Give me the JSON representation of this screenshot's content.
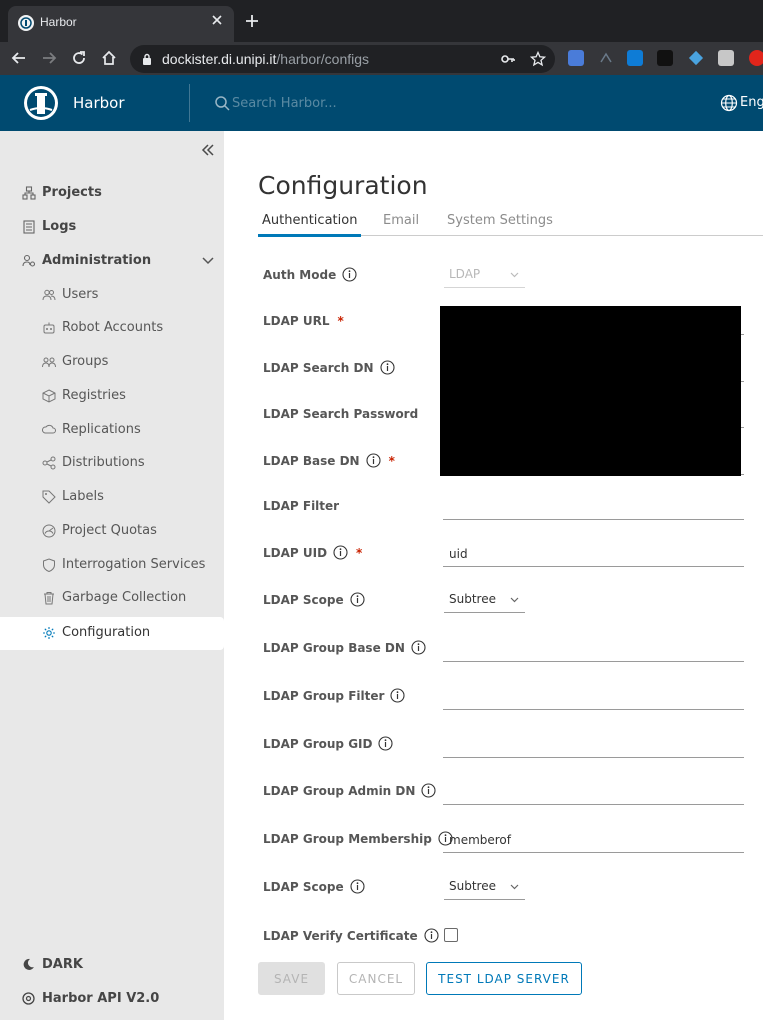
{
  "browser": {
    "tab_title": "Harbor",
    "url_host": "dockister.di.unipi.it",
    "url_path": "/harbor/configs"
  },
  "header": {
    "brand": "Harbor",
    "search_placeholder": "Search Harbor...",
    "language": "Eng",
    "bg_color": "#004a70"
  },
  "sidebar": {
    "items": [
      {
        "label": "Projects",
        "icon": "projects-icon"
      },
      {
        "label": "Logs",
        "icon": "logs-icon"
      },
      {
        "label": "Administration",
        "icon": "administration-icon"
      }
    ],
    "admin_items": [
      {
        "label": "Users",
        "icon": "users-icon"
      },
      {
        "label": "Robot Accounts",
        "icon": "robot-icon"
      },
      {
        "label": "Groups",
        "icon": "groups-icon"
      },
      {
        "label": "Registries",
        "icon": "registries-icon"
      },
      {
        "label": "Replications",
        "icon": "replications-icon"
      },
      {
        "label": "Distributions",
        "icon": "distributions-icon"
      },
      {
        "label": "Labels",
        "icon": "labels-icon"
      },
      {
        "label": "Project Quotas",
        "icon": "quotas-icon"
      },
      {
        "label": "Interrogation Services",
        "icon": "shield-icon"
      },
      {
        "label": "Garbage Collection",
        "icon": "trash-icon"
      },
      {
        "label": "Configuration",
        "icon": "gear-icon"
      }
    ],
    "active": "Configuration",
    "bottom": {
      "dark_label": "DARK",
      "api_label": "Harbor API V2.0"
    }
  },
  "main": {
    "title": "Configuration",
    "tabs": [
      {
        "label": "Authentication",
        "active": true
      },
      {
        "label": "Email",
        "active": false
      },
      {
        "label": "System Settings",
        "active": false
      }
    ],
    "form": {
      "auth_mode": {
        "label": "Auth Mode",
        "value": "LDAP",
        "disabled": true
      },
      "ldap_url": {
        "label": "LDAP URL",
        "required": true
      },
      "ldap_search_dn": {
        "label": "LDAP Search DN"
      },
      "ldap_search_password": {
        "label": "LDAP Search Password"
      },
      "ldap_base_dn": {
        "label": "LDAP Base DN",
        "required": true
      },
      "ldap_filter": {
        "label": "LDAP Filter",
        "value": ""
      },
      "ldap_uid": {
        "label": "LDAP UID",
        "required": true,
        "value": "uid"
      },
      "ldap_scope": {
        "label": "LDAP Scope",
        "value": "Subtree"
      },
      "ldap_group_base_dn": {
        "label": "LDAP Group Base DN",
        "value": ""
      },
      "ldap_group_filter": {
        "label": "LDAP Group Filter",
        "value": ""
      },
      "ldap_group_gid": {
        "label": "LDAP Group GID",
        "value": ""
      },
      "ldap_group_admin_dn": {
        "label": "LDAP Group Admin DN",
        "value": ""
      },
      "ldap_group_membership": {
        "label": "LDAP Group Membership",
        "value": "memberof"
      },
      "ldap_group_scope": {
        "label": "LDAP Scope",
        "value": "Subtree"
      },
      "ldap_verify_cert": {
        "label": "LDAP Verify Certificate",
        "checked": false
      }
    },
    "buttons": {
      "save": "SAVE",
      "cancel": "CANCEL",
      "test": "TEST LDAP SERVER"
    }
  }
}
